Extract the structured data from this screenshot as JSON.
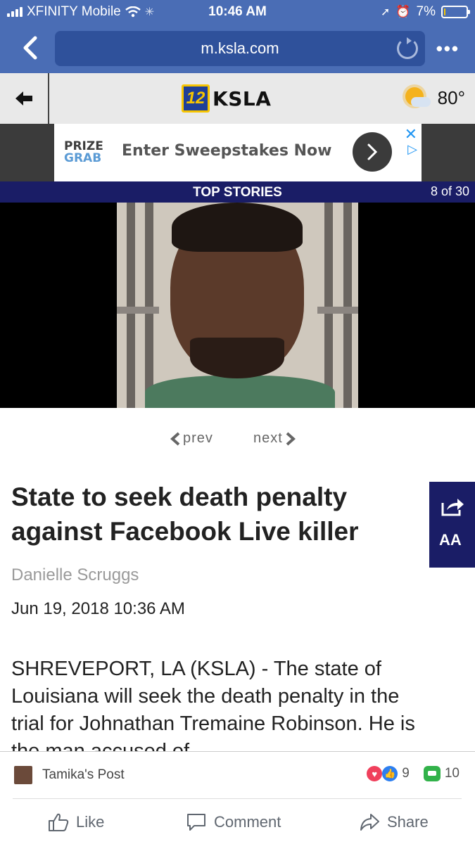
{
  "status_bar": {
    "carrier": "XFINITY Mobile",
    "time": "10:46 AM",
    "battery_label": "7%",
    "battery_level": 0.07
  },
  "browser": {
    "url": "m.ksla.com"
  },
  "site_header": {
    "logo_number": "12",
    "logo_name": "KSLA",
    "temperature": "80°"
  },
  "ad": {
    "brand_line1": "PRIZE",
    "brand_line2": "GRAB",
    "text": "Enter Sweepstakes Now"
  },
  "stories_bar": {
    "title": "TOP STORIES",
    "counter": "8 of 30"
  },
  "pager": {
    "prev": "prev",
    "next": "next"
  },
  "article": {
    "headline": "State to seek death penalty against Facebook Live killer",
    "author": "Danielle Scruggs",
    "date": "Jun 19, 2018 10:36 AM",
    "body": "SHREVEPORT, LA (KSLA) - The state of Louisiana will seek the death penalty in the trial for Johnathan Tremaine Robinson. He is the man accused of",
    "text_size_button": "AA"
  },
  "facebook": {
    "poster": "Tamika's Post",
    "reactions_count": "9",
    "comments_count": "10",
    "actions": [
      "Like",
      "Comment",
      "Share"
    ]
  },
  "colors": {
    "chrome_blue": "#4a6db5",
    "navy": "#1a1d66",
    "love_red": "#f0405c",
    "like_blue": "#2d7ff0",
    "comment_green": "#32b24a"
  }
}
